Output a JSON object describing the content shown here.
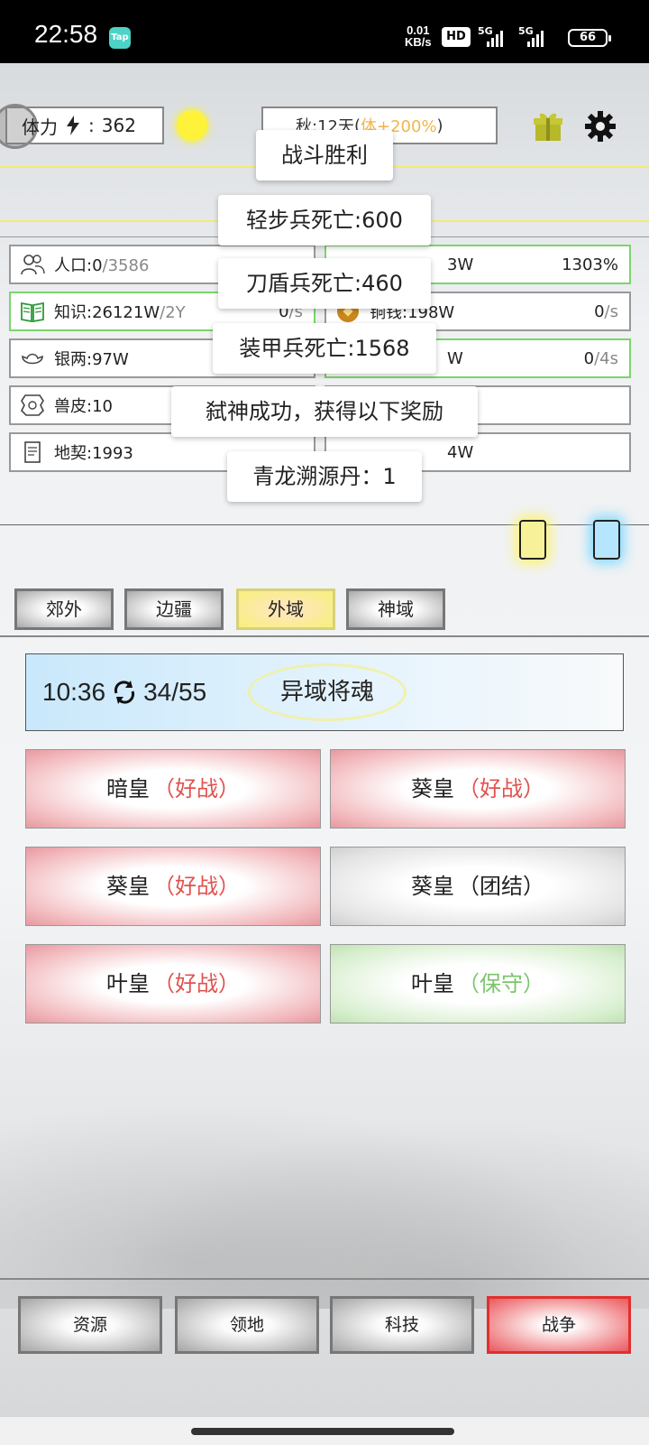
{
  "status_bar": {
    "time": "22:58",
    "tap_badge": "Tap",
    "net_speed_value": "0.01",
    "net_speed_unit": "KB/s",
    "hd_label": "HD",
    "signal1_label": "5G",
    "signal2_label": "5G",
    "battery": "66"
  },
  "hud": {
    "stamina_label": "体力",
    "stamina_value": "362",
    "season_text": "秋:12天",
    "season_bonus": "体+200%",
    "colors": {
      "sun": "#fff23a",
      "bonus": "#f0b64c",
      "gift": "#b7b82a"
    }
  },
  "stats": {
    "population": {
      "label": "人口:0",
      "max": "/3586"
    },
    "top_right_value": "3W",
    "top_right_percent": "1303%",
    "knowledge": {
      "label": "知识:26121W",
      "suffix": "/2Y",
      "rate": "0",
      "rate_unit": "/s"
    },
    "copper": {
      "label": "铜钱:198W",
      "rate": "0",
      "rate_unit": "/s"
    },
    "silver": {
      "label": "银两:97W"
    },
    "row3_right_value": "W",
    "row3_right_rate": "0",
    "row3_right_rate_unit": "/4s",
    "hide": {
      "label": "兽皮:10"
    },
    "deed": {
      "label": "地契:1993"
    },
    "row5_right_value": "4W"
  },
  "tabs": [
    "郊外",
    "边疆",
    "外域",
    "神域"
  ],
  "active_tab": "外域",
  "timer_panel": {
    "time": "10:36",
    "progress": "34/55",
    "soul_label": "异域将魂"
  },
  "enemies": [
    {
      "name": "暗皇",
      "trait": "（好战）",
      "kind": "warlike"
    },
    {
      "name": "葵皇",
      "trait": "（好战）",
      "kind": "warlike"
    },
    {
      "name": "葵皇",
      "trait": "（好战）",
      "kind": "warlike"
    },
    {
      "name": "葵皇",
      "trait": "（团结）",
      "kind": "united"
    },
    {
      "name": "叶皇",
      "trait": "（好战）",
      "kind": "warlike"
    },
    {
      "name": "叶皇",
      "trait": "（保守）",
      "kind": "defensive"
    }
  ],
  "bottom_nav": [
    "资源",
    "领地",
    "科技",
    "战争"
  ],
  "active_nav": "战争",
  "toasts": [
    "战斗胜利",
    "轻步兵死亡:600",
    "刀盾兵死亡:460",
    "装甲兵死亡:1568",
    "弑神成功，获得以下奖励",
    "青龙溯源丹：1"
  ]
}
